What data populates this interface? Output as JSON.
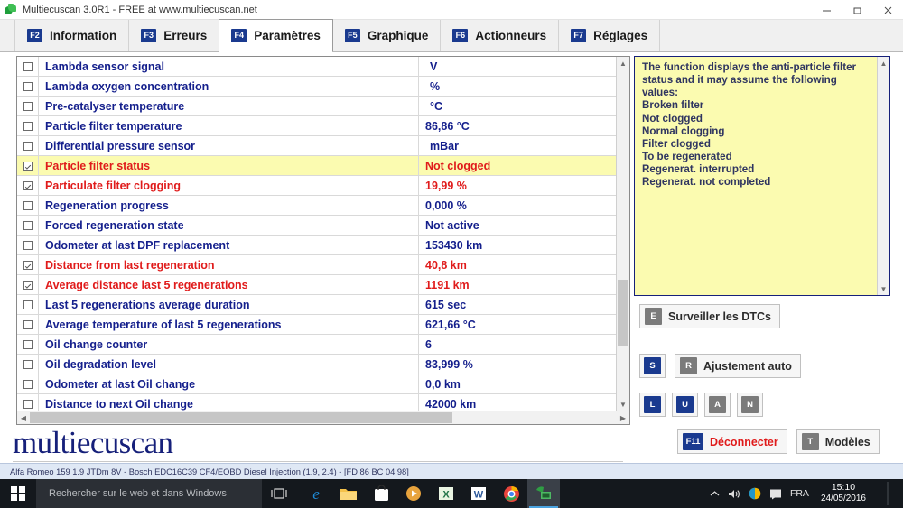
{
  "window": {
    "title": "Multiecuscan 3.0R1 - FREE at www.multiecuscan.net",
    "app_icon": "multiecuscan-leaf-icon",
    "minimize_label": "–",
    "maximize_label": "❐",
    "close_label": "✕"
  },
  "tabs": [
    {
      "key": "F2",
      "label": "Information",
      "active": false
    },
    {
      "key": "F3",
      "label": "Erreurs",
      "active": false
    },
    {
      "key": "F4",
      "label": "Paramètres",
      "active": true
    },
    {
      "key": "F5",
      "label": "Graphique",
      "active": false
    },
    {
      "key": "F6",
      "label": "Actionneurs",
      "active": false
    },
    {
      "key": "F7",
      "label": "Réglages",
      "active": false
    }
  ],
  "parameters": {
    "rows": [
      {
        "checked": false,
        "selected": false,
        "name": "Lambda sensor signal",
        "value": "V",
        "indent": true
      },
      {
        "checked": false,
        "selected": false,
        "name": "Lambda oxygen concentration",
        "value": "%",
        "indent": true
      },
      {
        "checked": false,
        "selected": false,
        "name": "Pre-catalyser temperature",
        "value": "°C",
        "indent": true
      },
      {
        "checked": false,
        "selected": false,
        "name": "Particle filter temperature",
        "value": "86,86 °C",
        "indent": false
      },
      {
        "checked": false,
        "selected": false,
        "name": "Differential pressure sensor",
        "value": "mBar",
        "indent": true
      },
      {
        "checked": true,
        "selected": true,
        "name": "Particle filter status",
        "value": "Not clogged",
        "indent": false
      },
      {
        "checked": true,
        "selected": false,
        "name": "Particulate filter clogging",
        "value": "19,99 %",
        "indent": false
      },
      {
        "checked": false,
        "selected": false,
        "name": "Regeneration progress",
        "value": "0,000 %",
        "indent": false
      },
      {
        "checked": false,
        "selected": false,
        "name": "Forced regeneration state",
        "value": "Not active",
        "indent": false
      },
      {
        "checked": false,
        "selected": false,
        "name": "Odometer at last DPF replacement",
        "value": "153430 km",
        "indent": false
      },
      {
        "checked": true,
        "selected": false,
        "name": "Distance from last regeneration",
        "value": "40,8 km",
        "indent": false
      },
      {
        "checked": true,
        "selected": false,
        "name": "Average distance last 5 regenerations",
        "value": "1191 km",
        "indent": false
      },
      {
        "checked": false,
        "selected": false,
        "name": "Last 5 regenerations average duration",
        "value": "615 sec",
        "indent": false
      },
      {
        "checked": false,
        "selected": false,
        "name": "Average temperature of last 5 regenerations",
        "value": "621,66 °C",
        "indent": false
      },
      {
        "checked": false,
        "selected": false,
        "name": "Oil change counter",
        "value": "6",
        "indent": false
      },
      {
        "checked": false,
        "selected": false,
        "name": "Oil degradation level",
        "value": "83,999 %",
        "indent": false
      },
      {
        "checked": false,
        "selected": false,
        "name": "Odometer at last Oil change",
        "value": "0,0 km",
        "indent": false
      },
      {
        "checked": false,
        "selected": false,
        "name": "Distance to next Oil change",
        "value": "42000 km",
        "indent": false
      }
    ]
  },
  "info_panel": {
    "text": "The function displays the anti-particle filter status and it may assume the following values:\nBroken filter\nNot clogged\nNormal clogging\nFilter clogged\nTo be regenerated\nRegenerat. interrupted\nRegenerat. not completed"
  },
  "actions": {
    "monitor_dtcs": {
      "key": "E",
      "label": "Surveiller les DTCs"
    },
    "auto_adjust": {
      "key": "R",
      "label": "Ajustement auto"
    },
    "s_button": {
      "key": "S"
    },
    "l_button": {
      "key": "L"
    },
    "u_button": {
      "key": "U"
    },
    "a_button": {
      "key": "A"
    },
    "n_button": {
      "key": "N"
    },
    "disconnect": {
      "key": "F11",
      "label": "Déconnecter"
    },
    "models": {
      "key": "T",
      "label": "Modèles"
    }
  },
  "logo": {
    "text": "multiecuscan"
  },
  "status_bar": {
    "text": "Alfa Romeo 159 1.9 JTDm 8V - Bosch EDC16C39 CF4/EOBD Diesel Injection (1.9, 2.4) - [FD 86 BC 04 98]"
  },
  "taskbar": {
    "start": "start-button",
    "search_placeholder": "Rechercher sur le web et dans Windows",
    "apps": [
      {
        "name": "edge",
        "glyph": "e"
      },
      {
        "name": "file-explorer",
        "glyph": ""
      },
      {
        "name": "store",
        "glyph": ""
      },
      {
        "name": "media-player",
        "glyph": "▶"
      },
      {
        "name": "excel",
        "glyph": "X"
      },
      {
        "name": "word",
        "glyph": "W"
      },
      {
        "name": "chrome",
        "glyph": ""
      },
      {
        "name": "multiecuscan",
        "glyph": ""
      }
    ],
    "language": "FRA",
    "time": "15:10",
    "date": "24/05/2016"
  },
  "colors": {
    "accent_blue": "#1a3a8f",
    "param_text": "#141f8c",
    "alert_red": "#e01b1b",
    "highlight_yellow": "#fbfbb0"
  }
}
